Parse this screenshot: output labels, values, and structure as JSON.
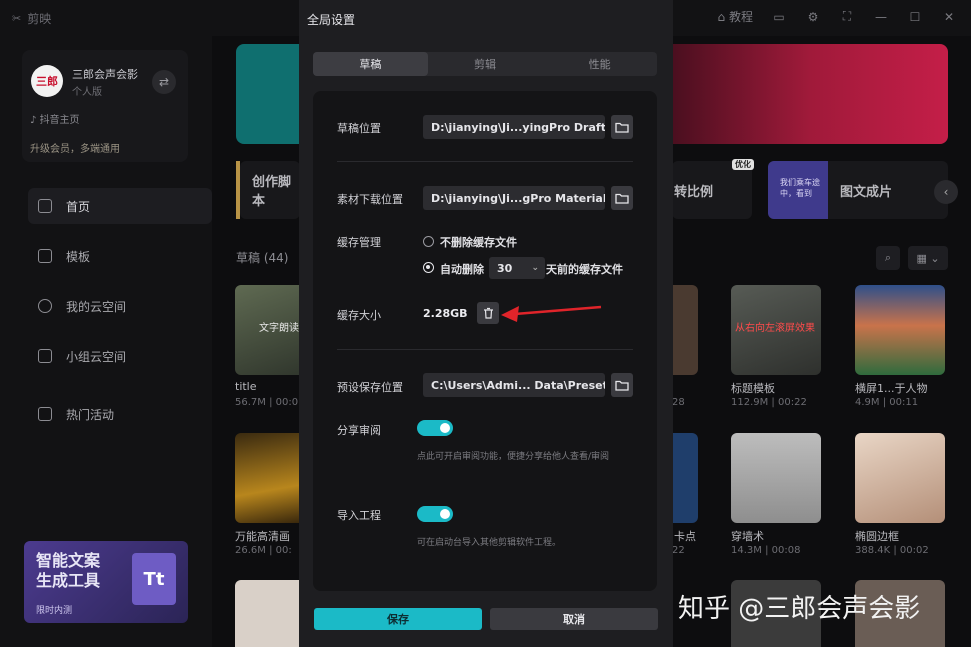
{
  "app": {
    "name": "剪映",
    "tutorial_label": "教程",
    "user_name": "三郎会声会影",
    "avatar_text": "三郎",
    "user_type": "个人版",
    "douyin_label": "抖音主页",
    "upgrade_label": "升级会员，多端通用",
    "nav": [
      "首页",
      "模板",
      "我的云空间",
      "小组云空间",
      "热门活动"
    ],
    "promo_line1": "智能文案",
    "promo_line2": "生成工具",
    "promo_sub": "限时内测",
    "features": [
      "创作脚本",
      "转比例",
      "图文成片"
    ],
    "feature_tag": "优化",
    "feature_thumb_text": "我们乘车途中，看到",
    "drafts_heading": "草稿 (44)",
    "cards": [
      {
        "title": "title",
        "meta": "56.7M | 00:0",
        "thumb_text": "文字朗读"
      },
      {
        "title": "标题模板",
        "meta": "112.9M | 00:22",
        "thumb_text": "从右向左滚屏效果"
      },
      {
        "title": "横屏1...于人物",
        "meta": "4.9M | 00:11",
        "thumb_text": ""
      },
      {
        "title": "万能高清画",
        "meta": "26.6M | 00:",
        "thumb_text": ""
      },
      {
        "title": "穿墙术",
        "meta": "14.3M | 00:08",
        "thumb_text": ""
      },
      {
        "title": "椭圆边框",
        "meta": "388.4K | 00:02",
        "thumb_text": ""
      }
    ],
    "partial_texts": [
      "28",
      "卡点",
      "22"
    ]
  },
  "watermark": "知乎 @三郎会声会影",
  "modal": {
    "title": "全局设置",
    "tabs": [
      "草稿",
      "剪辑",
      "性能"
    ],
    "draft_location_label": "草稿位置",
    "draft_location_value": "D:\\jianying\\Ji...yingPro Drafts",
    "material_location_label": "素材下载位置",
    "material_location_value": "D:\\jianying\\Ji...gPro Materials",
    "cache_manage_label": "缓存管理",
    "cache_option_keep": "不删除缓存文件",
    "cache_option_auto": "自动删除",
    "cache_days": "30",
    "cache_days_suffix": "天前的缓存文件",
    "cache_size_label": "缓存大小",
    "cache_size_value": "2.28GB",
    "preset_location_label": "预设保存位置",
    "preset_location_value": "C:\\Users\\Admi... Data\\Presets",
    "share_review_label": "分享审阅",
    "share_review_on": true,
    "share_review_hint": "点此可开启审阅功能，便捷分享给他人查看/审阅",
    "import_project_label": "导入工程",
    "import_project_on": true,
    "import_project_hint": "可在启动台导入其他剪辑软件工程。",
    "save_label": "保存",
    "cancel_label": "取消"
  },
  "colors": {
    "accent": "#1bbac7",
    "arrow": "#e0242a",
    "modal_bg": "#1e1e21",
    "panel_bg": "#141416"
  }
}
